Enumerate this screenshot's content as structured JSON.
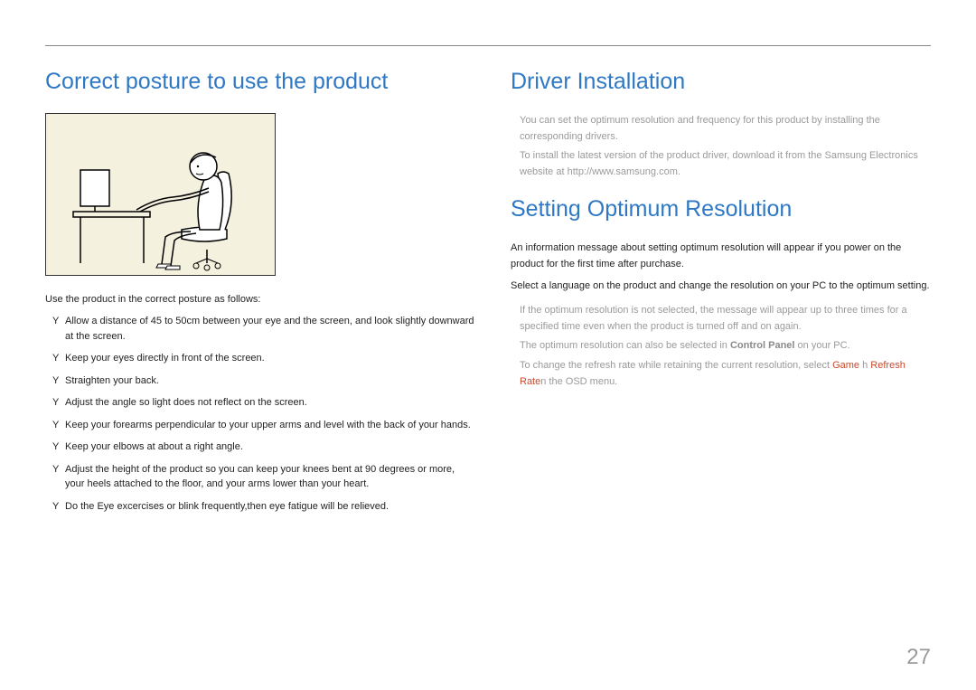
{
  "page_number": "27",
  "left": {
    "heading": "Correct posture to use the product",
    "intro": "Use the product in the correct posture as follows:",
    "bullets": [
      "Allow a distance of 45 to 50cm between your eye and the screen, and look slightly downward at the screen.",
      "Keep your eyes directly in front of the screen.",
      "Straighten your back.",
      "Adjust the angle so light does not reflect on the screen.",
      "Keep your forearms perpendicular to your upper arms and level with the back of your hands.",
      "Keep your elbows at about a right angle.",
      "Adjust the height of the product so you can keep your knees bent at 90 degrees or more, your heels attached to the floor, and your arms lower than your heart.",
      "Do the Eye excercises or blink frequently,then eye fatigue will be relieved."
    ]
  },
  "right": {
    "heading_a": "Driver Installation",
    "note_a_1": "You can set the optimum resolution and frequency for this product by installing the corresponding drivers.",
    "note_a_2": "To install the latest version of the product driver, download it from the Samsung Electronics website at http://www.samsung.com.",
    "heading_b": "Setting Optimum Resolution",
    "body_b_1": "An information message about setting optimum resolution will appear if you power on the product for the first time after purchase.",
    "body_b_2": "Select a language on the product and change the resolution on your PC to the optimum setting.",
    "note_b_1": "If the optimum resolution is not selected, the message will appear up to three times for a specified time even when the product is turned off and on again.",
    "note_b_2_pre": "The optimum resolution can also be selected in ",
    "note_b_2_bold": "Control Panel",
    "note_b_2_post": " on your PC.",
    "note_b_3_pre": "To change the refresh rate while retaining the current resolution, select ",
    "note_b_3_c1": "Game",
    "note_b_3_mid": "   h   ",
    "note_b_3_c2": "Refresh Rate",
    "note_b_3_post": "n the OSD menu."
  }
}
